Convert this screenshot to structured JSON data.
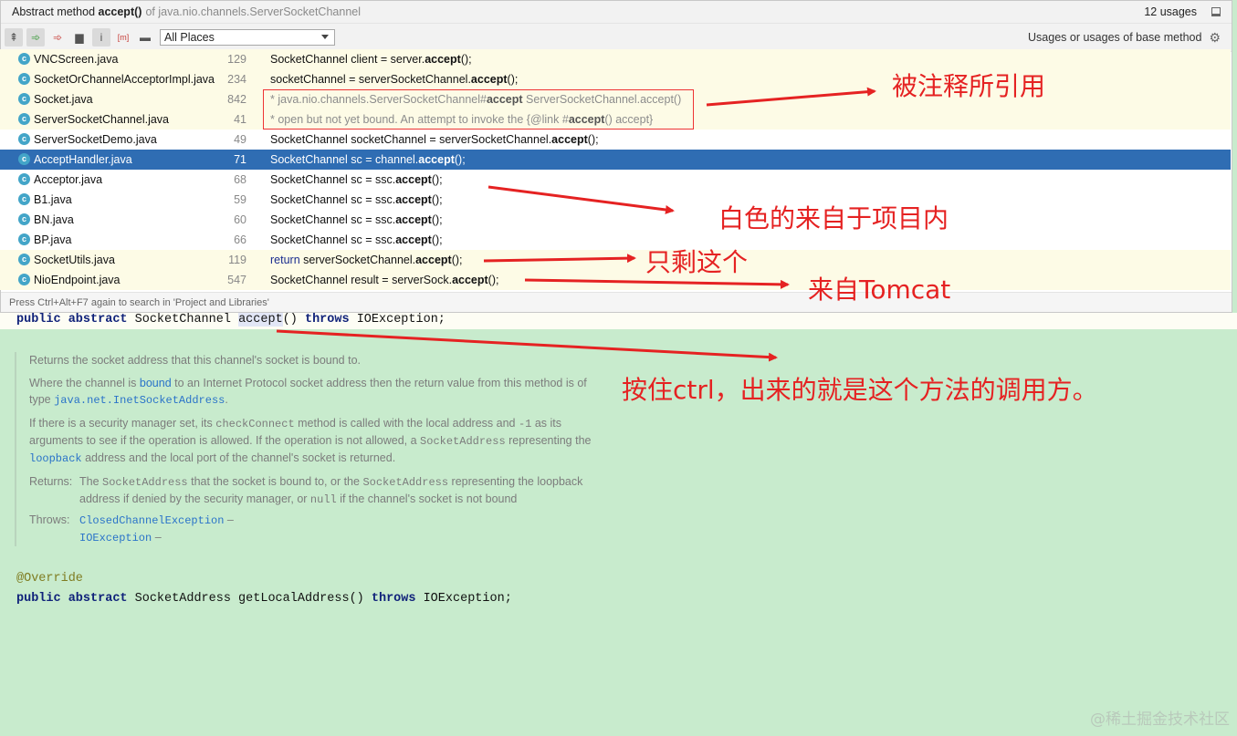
{
  "popup": {
    "title_prefix": "Abstract method ",
    "title_method": "accept()",
    "title_suffix": "of java.nio.channels.ServerSocketChannel",
    "usages": "12 usages",
    "scope_select": "All Places",
    "scope_label": "Usages or usages of base method",
    "hint": "Press Ctrl+Alt+F7 again to search in 'Project and Libraries'"
  },
  "rows": [
    {
      "file": "VNCScreen.java",
      "line": "129",
      "pre": "SocketChannel client = server.",
      "bold": "accept",
      "post": "();",
      "kind": "lib"
    },
    {
      "file": "SocketOrChannelAcceptorImpl.java",
      "line": "234",
      "pre": "socketChannel = serverSocketChannel.",
      "bold": "accept",
      "post": "();",
      "kind": "lib"
    },
    {
      "file": "Socket.java",
      "line": "842",
      "pre": "* java.nio.channels.ServerSocketChannel#",
      "bold": "accept",
      "post": " ServerSocketChannel.accept()",
      "kind": "lib-comment"
    },
    {
      "file": "ServerSocketChannel.java",
      "line": "41",
      "pre": "* open but not yet bound.  An attempt to invoke the {@link #",
      "bold": "accept",
      "post": "() accept}",
      "kind": "lib-comment"
    },
    {
      "file": "ServerSocketDemo.java",
      "line": "49",
      "pre": "SocketChannel socketChannel = serverSocketChannel.",
      "bold": "accept",
      "post": "();",
      "kind": "proj"
    },
    {
      "file": "AcceptHandler.java",
      "line": "71",
      "pre": "SocketChannel sc = channel.",
      "bold": "accept",
      "post": "();",
      "kind": "selected"
    },
    {
      "file": "Acceptor.java",
      "line": "68",
      "pre": "SocketChannel sc = ssc.",
      "bold": "accept",
      "post": "();",
      "kind": "proj"
    },
    {
      "file": "B1.java",
      "line": "59",
      "pre": "SocketChannel sc = ssc.",
      "bold": "accept",
      "post": "();",
      "kind": "proj"
    },
    {
      "file": "BN.java",
      "line": "60",
      "pre": "SocketChannel sc = ssc.",
      "bold": "accept",
      "post": "();",
      "kind": "proj"
    },
    {
      "file": "BP.java",
      "line": "66",
      "pre": "SocketChannel sc = ssc.",
      "bold": "accept",
      "post": "();",
      "kind": "proj"
    },
    {
      "file": "SocketUtils.java",
      "line": "119",
      "kw": "return",
      "pre": " serverSocketChannel.",
      "bold": "accept",
      "post": "();",
      "kind": "lib"
    },
    {
      "file": "NioEndpoint.java",
      "line": "547",
      "pre": "SocketChannel result = serverSock.",
      "bold": "accept",
      "post": "();",
      "kind": "lib"
    }
  ],
  "editor": {
    "sig_kw": "public abstract",
    "sig_type": " SocketChannel ",
    "sig_method": "accept",
    "sig_paren": "() ",
    "sig_throws": "throws",
    "sig_exc": " IOException;",
    "doc_summary": "Returns the socket address that this channel's socket is bound to.",
    "doc_p2_a": "Where the channel is ",
    "doc_p2_link": "bound",
    "doc_p2_b": " to an Internet Protocol socket address then the return value from this method is of type ",
    "doc_p2_code": "java.net.InetSocketAddress",
    "doc_p2_c": ".",
    "doc_p3_a": "If there is a security manager set, its ",
    "doc_p3_code1": "checkConnect",
    "doc_p3_b": " method is called with the local address and ",
    "doc_p3_code2": "-1",
    "doc_p3_c": " as its arguments to see if the operation is allowed. If the operation is not allowed, a ",
    "doc_p3_code3": "SocketAddress",
    "doc_p3_d": " representing the ",
    "doc_p3_link": "loopback",
    "doc_p3_e": " address and the local port of the channel's socket is returned.",
    "returns_label": "Returns:",
    "returns_a": "The ",
    "returns_code1": "SocketAddress",
    "returns_b": " that the socket is bound to, or the ",
    "returns_code2": "SocketAddress",
    "returns_c": " representing the loopback address if denied by the security manager, or ",
    "returns_code3": "null",
    "returns_d": " if the channel's socket is not bound",
    "throws_label": "Throws:",
    "throws_1": "ClosedChannelException",
    "throws_2": "IOException",
    "throws_dash": " –",
    "override": "@Override",
    "sig2_kw": "public abstract",
    "sig2_mid": " SocketAddress getLocalAddress() ",
    "sig2_throws": "throws",
    "sig2_exc": " IOException;"
  },
  "annotations": {
    "a1": "被注释所引用",
    "a2": "白色的来自于项目内",
    "a3": "只剩这个",
    "a4": "来自Tomcat",
    "a5": "按住ctrl，出来的就是这个方法的调用方。"
  },
  "watermark": "@稀土掘金技术社区",
  "colors": {
    "annotation": "#e52222",
    "selection": "#2f6db3",
    "library_row": "#fdfbe6",
    "editor_bg": "#c8ebcd"
  }
}
